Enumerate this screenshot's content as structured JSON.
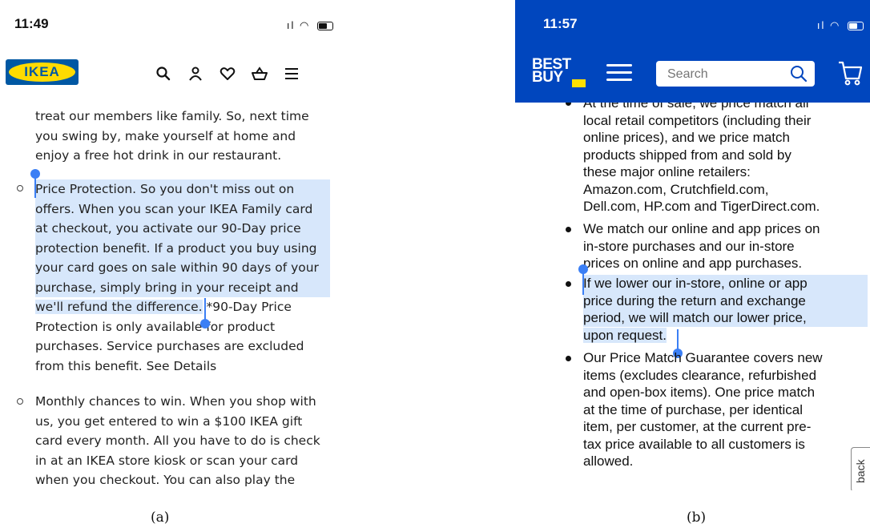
{
  "panel_a": {
    "status": {
      "time": "11:49"
    },
    "logo_text": "IKEA",
    "header_icons": [
      "search-icon",
      "account-icon",
      "heart-icon",
      "basket-icon",
      "menu-icon"
    ],
    "intro_lines": [
      "treat our members like family. So, next time",
      "you swing by, make yourself at home and",
      "enjoy a free hot drink in our restaurant."
    ],
    "price_protection": {
      "highlighted_lines": [
        "Price Protection. So you don't miss out on",
        "offers. When you scan your IKEA Family card",
        "at checkout, you activate our 90-Day price",
        "protection benefit. If a product you buy using",
        "your card goes on sale within 90 days of your",
        "purchase, simply bring in your receipt and"
      ],
      "last_highlight": "we'll refund the difference.",
      "after_highlight": " *90-Day Price",
      "rest_lines": [
        "Protection is only available for product",
        "purchases. Service purchases are excluded",
        "from this benefit. See Details"
      ]
    },
    "monthly_lines": [
      "Monthly chances to win. When you shop with",
      "us, you get entered to win a $100 IKEA gift",
      "card every month. All you have to do is check",
      "in at an IKEA store kiosk or scan your card",
      "when you checkout. You can also play the"
    ]
  },
  "panel_b": {
    "status": {
      "time": "11:57"
    },
    "logo_line1": "BEST",
    "logo_line2": "BUY",
    "search_placeholder": "Search",
    "header_icons": [
      "menu-icon",
      "search-icon",
      "cart-icon"
    ],
    "item1_lines": [
      "At the time of sale, we price match all",
      "local retail competitors (including their",
      "online prices), and we price match",
      "products shipped from and sold by",
      "these major online retailers:",
      "Amazon.com, Crutchfield.com,",
      "Dell.com, HP.com and TigerDirect.com."
    ],
    "item2_lines": [
      "We match our online and app prices on",
      "in-store purchases and our in-store",
      "prices on online and app purchases."
    ],
    "item3_lines": [
      "If we lower our in-store, online or app",
      "price during the return and exchange",
      "period, we will match our lower price,",
      "upon request."
    ],
    "item4_lines": [
      "Our Price Match Guarantee covers new",
      "items (excludes clearance, refurbished",
      "and open-box items). One price match",
      "at the time of purchase, per identical",
      "item, per customer, at the current pre-",
      "tax price available to all customers is",
      "allowed."
    ],
    "feedback_label": "back"
  },
  "captions": {
    "a": "(a)",
    "b": "(b)"
  },
  "colors": {
    "ikea_blue": "#0058a3",
    "ikea_yellow": "#ffdb00",
    "bestbuy_blue": "#0046be",
    "bestbuy_yellow": "#ffe000",
    "selection": "#d7e7fb",
    "handle": "#3b7ff5"
  }
}
